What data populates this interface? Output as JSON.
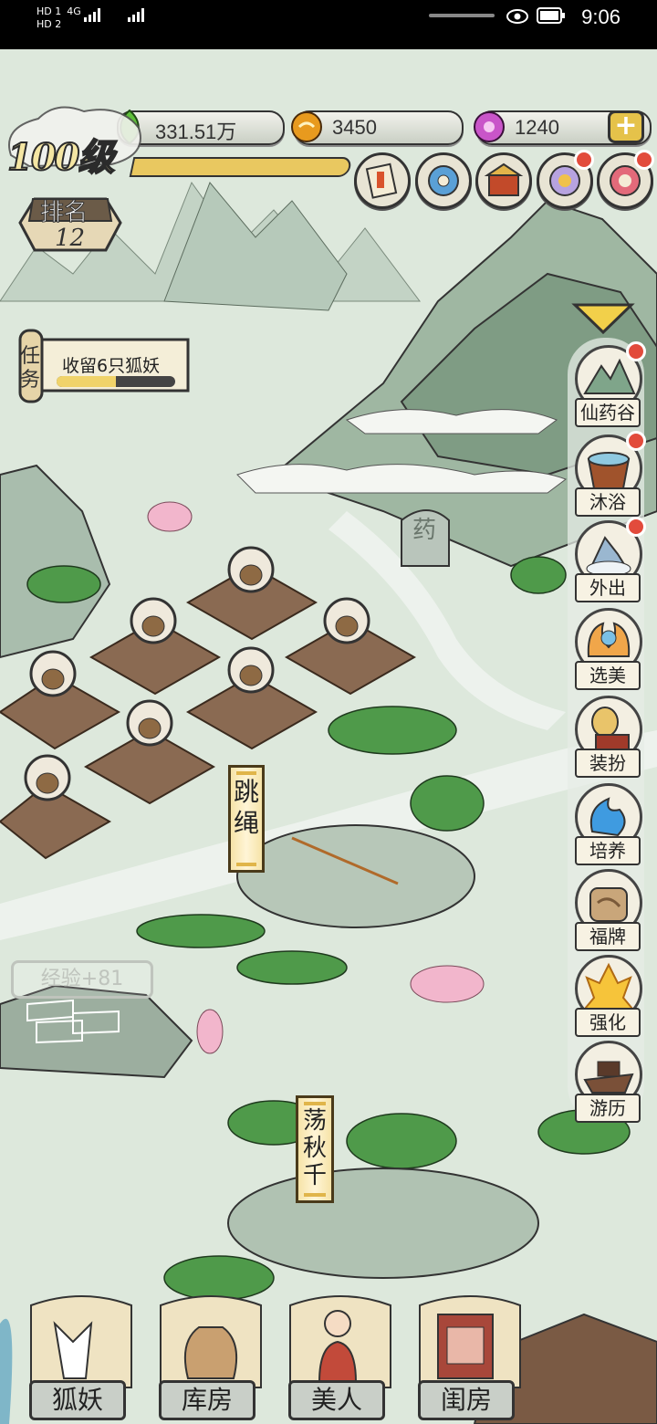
{
  "status_bar": {
    "sim1": "HD 1",
    "sim2": "HD 2",
    "net1": "4G",
    "net2": "4G",
    "time": "9:06"
  },
  "hud": {
    "level": "100级",
    "rank_label": "排名",
    "rank_value": "12",
    "resources": [
      {
        "name": "jade-leaf",
        "value": "331.51万",
        "color": "#5fbf3a"
      },
      {
        "name": "gold-coin",
        "value": "3450",
        "color": "#e89a1e"
      },
      {
        "name": "purple-gem",
        "value": "1240",
        "color": "#c955c9"
      }
    ],
    "plus": "+"
  },
  "task": {
    "label": "任务",
    "text": "收留6只狐妖",
    "progress": 0.5
  },
  "side_menu": [
    {
      "label": "仙药谷",
      "icon": "mountain-valley-icon",
      "badge": true
    },
    {
      "label": "沐浴",
      "icon": "bathtub-icon",
      "badge": true
    },
    {
      "label": "外出",
      "icon": "cloud-peak-icon",
      "badge": true
    },
    {
      "label": "选美",
      "icon": "beauty-pageant-icon",
      "badge": false
    },
    {
      "label": "装扮",
      "icon": "vanity-mirror-icon",
      "badge": false
    },
    {
      "label": "培养",
      "icon": "water-spirit-icon",
      "badge": false
    },
    {
      "label": "福牌",
      "icon": "fortune-tablet-icon",
      "badge": false
    },
    {
      "label": "强化",
      "icon": "flame-burst-icon",
      "badge": false
    },
    {
      "label": "游历",
      "icon": "boat-icon",
      "badge": false
    }
  ],
  "map_signs": {
    "jump_rope": "跳绳",
    "swing": "荡秋千",
    "exp_popup": "经验+81",
    "herb_stone": "药"
  },
  "bottom_nav": [
    {
      "label": "狐妖",
      "icon": "fox-icon"
    },
    {
      "label": "库房",
      "icon": "sack-icon"
    },
    {
      "label": "美人",
      "icon": "beauty-icon"
    },
    {
      "label": "闺房",
      "icon": "boudoir-icon"
    }
  ]
}
